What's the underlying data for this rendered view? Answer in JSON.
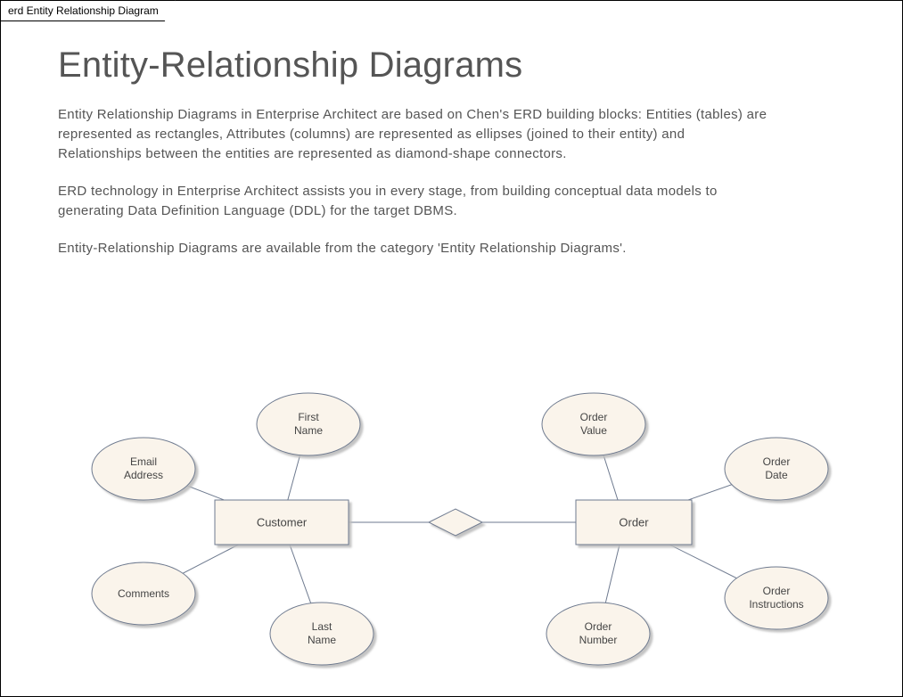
{
  "tab_label": "erd Entity Relationship Diagram",
  "title": "Entity-Relationship Diagrams",
  "paragraphs": [
    "Entity Relationship Diagrams in Enterprise Architect are based on Chen's ERD building blocks: Entities (tables) are represented as rectangles, Attributes (columns) are represented as ellipses (joined to their entity) and Relationships between the entities are represented as diamond-shape connectors.",
    "ERD technology in Enterprise Architect assists you in every stage, from building conceptual data models to generating Data Definition Language (DDL) for the target DBMS.",
    "Entity-Relationship Diagrams are available from the category 'Entity Relationship Diagrams'."
  ],
  "erd": {
    "entities": [
      {
        "id": "customer",
        "label": "Customer"
      },
      {
        "id": "order",
        "label": "Order"
      }
    ],
    "relationship": {
      "id": "rel",
      "between": [
        "customer",
        "order"
      ],
      "label": ""
    },
    "attributes": {
      "customer": [
        {
          "id": "email",
          "label": "Email Address"
        },
        {
          "id": "firstname",
          "label": "First Name"
        },
        {
          "id": "comments",
          "label": "Comments"
        },
        {
          "id": "lastname",
          "label": "Last Name"
        }
      ],
      "order": [
        {
          "id": "ordervalue",
          "label": "Order Value"
        },
        {
          "id": "orderdate",
          "label": "Order Date"
        },
        {
          "id": "ordernumber",
          "label": "Order Number"
        },
        {
          "id": "orderinstr",
          "label": "Order Instructions"
        }
      ]
    }
  },
  "colors": {
    "shape_fill": "#FAF4EB",
    "shape_stroke": "#6E7A8F",
    "shadow": "#CBCBCB"
  }
}
